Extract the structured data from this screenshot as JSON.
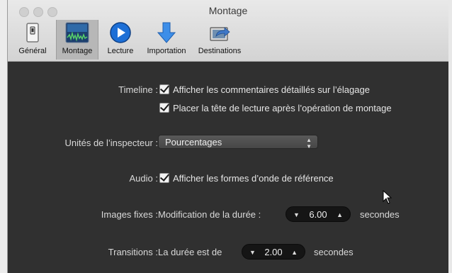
{
  "window": {
    "title": "Montage"
  },
  "toolbar": {
    "tabs": [
      {
        "label": "Général",
        "icon": "switch-icon",
        "selected": false
      },
      {
        "label": "Montage",
        "icon": "waveform-icon",
        "selected": true
      },
      {
        "label": "Lecture",
        "icon": "play-icon",
        "selected": false
      },
      {
        "label": "Importation",
        "icon": "down-arrow-icon",
        "selected": false
      },
      {
        "label": "Destinations",
        "icon": "share-icon",
        "selected": false
      }
    ]
  },
  "timeline": {
    "label": "Timeline :",
    "options": [
      {
        "label": "Afficher les commentaires détaillés sur l’élagage",
        "checked": true
      },
      {
        "label": "Placer la tête de lecture après l’opération de montage",
        "checked": true
      }
    ]
  },
  "inspector": {
    "label": "Unités de l’inspecteur :",
    "value": "Pourcentages"
  },
  "audio": {
    "label": "Audio :",
    "option": "Afficher les formes d’onde de référence",
    "checked": true
  },
  "still_images": {
    "label": "Images fixes :",
    "prefix": "Modification de la durée :",
    "value": "6.00",
    "suffix": "secondes"
  },
  "transitions": {
    "label": "Transitions :",
    "prefix": "La durée est de",
    "value": "2.00",
    "suffix": "secondes"
  }
}
